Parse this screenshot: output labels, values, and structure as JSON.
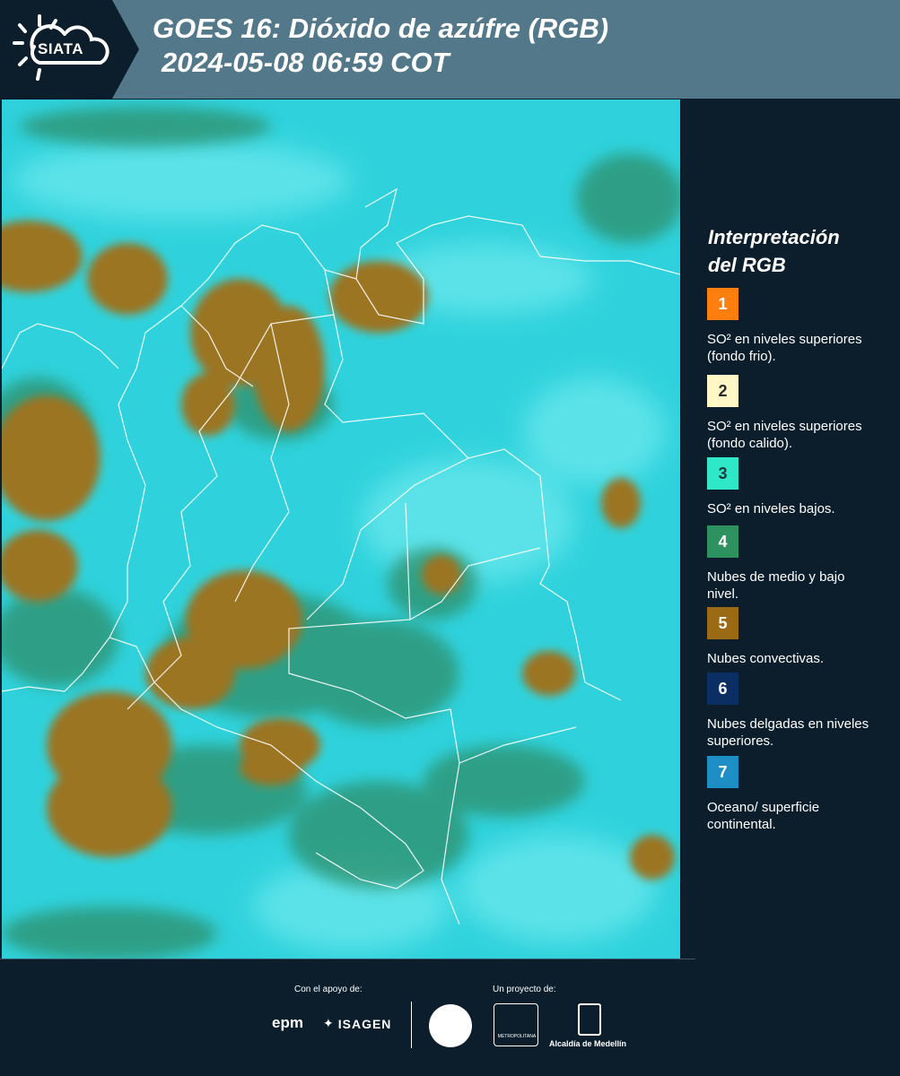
{
  "header": {
    "logo_text": "SIATA",
    "title_line1": "GOES 16: Dióxido de azúfre (RGB)",
    "title_line2": "2024-05-08 06:59 COT"
  },
  "legend": {
    "title_line1": "Interpretación",
    "title_line2": "del RGB",
    "items": [
      {
        "number": "1",
        "label": "SO² en niveles superiores (fondo frio).",
        "color": "#ff7f0e",
        "text_color": "#ffffff"
      },
      {
        "number": "2",
        "label": "SO² en niveles superiores (fondo calido).",
        "color": "#fff8c6",
        "text_color": "#2a2a2a"
      },
      {
        "number": "3",
        "label": "SO² en niveles bajos.",
        "color": "#2ee8c8",
        "text_color": "#1f3a3a"
      },
      {
        "number": "4",
        "label": "Nubes de medio y bajo nivel.",
        "color": "#2e9160",
        "text_color": "#ffffff"
      },
      {
        "number": "5",
        "label": "Nubes convectivas.",
        "color": "#9b6a14",
        "text_color": "#ffffff"
      },
      {
        "number": "6",
        "label": "Nubes delgadas en niveles superiores.",
        "color": "#0b2e63",
        "text_color": "#ffffff"
      },
      {
        "number": "7",
        "label": "Oceano/ superficie continental.",
        "color": "#1e8fc4",
        "text_color": "#ffffff"
      }
    ]
  },
  "footer": {
    "support_label": "Con el apoyo de:",
    "project_label": "Un proyecto de:",
    "sponsors": [
      "epm",
      "ISAGEN"
    ],
    "partners": [
      "Área Metropolitana Valle de Aburrá",
      "Alcaldía de Medellín"
    ],
    "amva_logo_text": "METROPOLITANA",
    "alcaldia_label": "Alcaldía de Medellín"
  },
  "map": {
    "colors": {
      "background": "#2fd2dc",
      "cyan_light": "#5ee8ee",
      "green": "#2f8f6a",
      "convective": "#9b7420"
    }
  }
}
